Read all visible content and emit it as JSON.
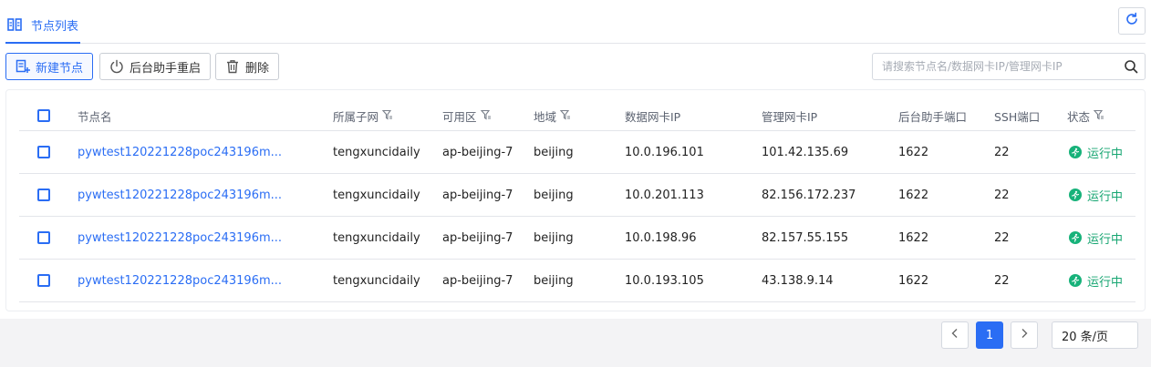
{
  "tabs": [
    {
      "label": "节点列表",
      "icon": "columns-icon",
      "active": true
    }
  ],
  "colors": {
    "primary": "#2a6df4",
    "status_running": "#17b27a",
    "border": "#e3e5ea"
  },
  "toolbar": {
    "new_node": "新建节点",
    "restart_assistant": "后台助手重启",
    "delete": "删除"
  },
  "search": {
    "placeholder": "请搜索节点名/数据网卡IP/管理网卡IP",
    "value": ""
  },
  "table": {
    "columns": {
      "name": "节点名",
      "subnet": "所属子网",
      "zone": "可用区",
      "region": "地域",
      "data_ip": "数据网卡IP",
      "mgmt_ip": "管理网卡IP",
      "assistant_port": "后台助手端口",
      "ssh_port": "SSH端口",
      "status": "状态"
    },
    "rows": [
      {
        "name": "pywtest120221228poc243196m...",
        "subnet": "tengxuncidaily",
        "zone": "ap-beijing-7",
        "region": "beijing",
        "data_ip": "10.0.196.101",
        "mgmt_ip": "101.42.135.69",
        "assistant_port": "1622",
        "ssh_port": "22",
        "status": "运行中"
      },
      {
        "name": "pywtest120221228poc243196m...",
        "subnet": "tengxuncidaily",
        "zone": "ap-beijing-7",
        "region": "beijing",
        "data_ip": "10.0.201.113",
        "mgmt_ip": "82.156.172.237",
        "assistant_port": "1622",
        "ssh_port": "22",
        "status": "运行中"
      },
      {
        "name": "pywtest120221228poc243196m...",
        "subnet": "tengxuncidaily",
        "zone": "ap-beijing-7",
        "region": "beijing",
        "data_ip": "10.0.198.96",
        "mgmt_ip": "82.157.55.155",
        "assistant_port": "1622",
        "ssh_port": "22",
        "status": "运行中"
      },
      {
        "name": "pywtest120221228poc243196m...",
        "subnet": "tengxuncidaily",
        "zone": "ap-beijing-7",
        "region": "beijing",
        "data_ip": "10.0.193.105",
        "mgmt_ip": "43.138.9.14",
        "assistant_port": "1622",
        "ssh_port": "22",
        "status": "运行中"
      }
    ]
  },
  "pagination": {
    "current_page": "1",
    "page_size": "20 条/页"
  }
}
